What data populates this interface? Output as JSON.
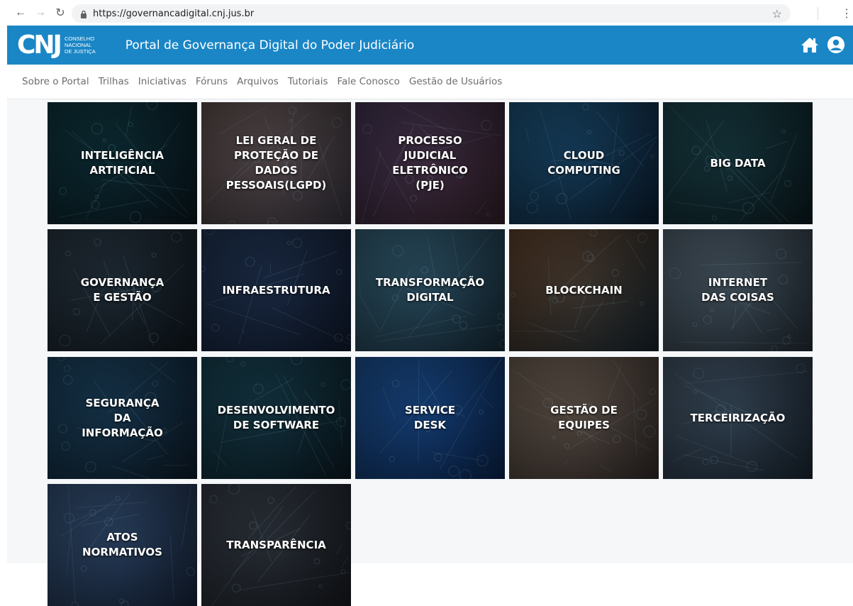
{
  "browser": {
    "url": "https://governancadigital.cnj.jus.br"
  },
  "header": {
    "logo_mark": "CNJ",
    "logo_line1": "Conselho",
    "logo_line2": "Nacional",
    "logo_line3": "de Justiça",
    "title": "Portal de Governança Digital do Poder Judiciário"
  },
  "menu": {
    "items": [
      "Sobre o Portal",
      "Trilhas",
      "Iniciativas",
      "Fóruns",
      "Arquivos",
      "Tutoriais",
      "Fale Conosco",
      "Gestão de Usuários"
    ]
  },
  "tiles": [
    {
      "label": "INTELIGÊNCIA\nARTIFICIAL",
      "color1": "#0f3c46",
      "color2": "#0a1a22"
    },
    {
      "label": "LEI GERAL DE\nPROTEÇÃO DE\nDADOS\nPESSOAIS(LGPD)",
      "color1": "#6b5a58",
      "color2": "#3e3a44"
    },
    {
      "label": "PROCESSO\nJUDICIAL\nELETRÔNICO\n(PJE)",
      "color1": "#4a3a5a",
      "color2": "#3a2430"
    },
    {
      "label": "CLOUD\nCOMPUTING",
      "color1": "#1f5b85",
      "color2": "#0c2238"
    },
    {
      "label": "BIG DATA",
      "color1": "#1d4a52",
      "color2": "#0c1e24"
    },
    {
      "label": "GOVERNANÇA\nE GESTÃO",
      "color1": "#2e3d4a",
      "color2": "#101a22"
    },
    {
      "label": "INFRAESTRUTURA",
      "color1": "#243a5c",
      "color2": "#121e34"
    },
    {
      "label": "TRANSFORMAÇÃO\nDIGITAL",
      "color1": "#3a6a82",
      "color2": "#1a3242"
    },
    {
      "label": "BLOCKCHAIN",
      "color1": "#6a4a32",
      "color2": "#1a2a34"
    },
    {
      "label": "INTERNET\nDAS COISAS",
      "color1": "#5c6e7c",
      "color2": "#28343e"
    },
    {
      "label": "SEGURANÇA\nDA\nINFORMAÇÃO",
      "color1": "#1e4a6a",
      "color2": "#0e2030"
    },
    {
      "label": "DESENVOLVIMENTO\nDE SOFTWARE",
      "color1": "#1a4a5c",
      "color2": "#0c1e28"
    },
    {
      "label": "SERVICE\nDESK",
      "color1": "#1f5aa2",
      "color2": "#0c2a5a"
    },
    {
      "label": "GESTÃO DE\nEQUIPES",
      "color1": "#7a6a5c",
      "color2": "#3a3230"
    },
    {
      "label": "TERCEIRIZAÇÃO",
      "color1": "#4a5e72",
      "color2": "#1e2c3a"
    },
    {
      "label": "ATOS\nNORMATIVOS",
      "color1": "#3a5a82",
      "color2": "#1a2a44"
    },
    {
      "label": "TRANSPARÊNCIA",
      "color1": "#3c4450",
      "color2": "#1a1e24"
    }
  ],
  "icons": {
    "back": "back-arrow-icon",
    "forward": "forward-arrow-icon",
    "reload": "reload-icon",
    "lock": "lock-icon",
    "star": "star-icon",
    "menu": "kebab-menu-icon",
    "home": "home-icon",
    "user": "user-icon"
  },
  "colors": {
    "header_bg": "#1a86c6",
    "menu_text": "#6d6d6d",
    "content_bg": "#f5f7f9"
  }
}
